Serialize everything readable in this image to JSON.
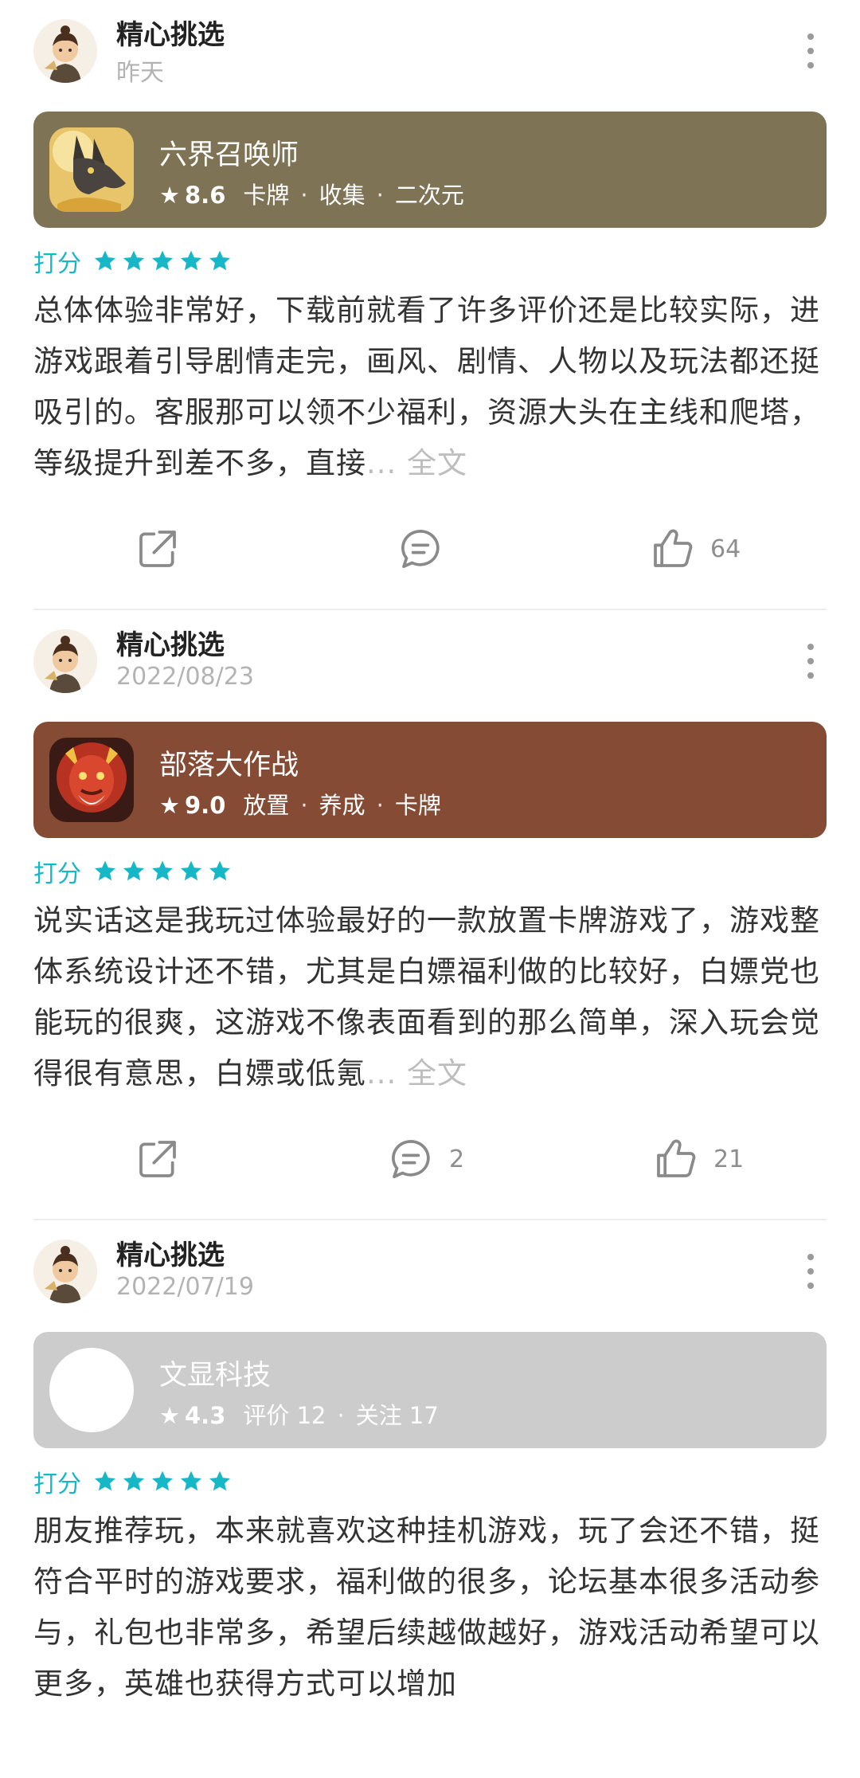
{
  "posts": [
    {
      "author": "精心挑选",
      "date": "昨天",
      "game": {
        "name": "六界召唤师",
        "score": "8.6",
        "tags": [
          "卡牌",
          "收集",
          "二次元"
        ],
        "bg_color": "#7f7355",
        "icon": "anubis-dog-icon"
      },
      "rating_label": "打分",
      "stars": 5,
      "content": "总体体验非常好，下载前就看了许多评价还是比较实际，进游戏跟着引导剧情走完，画风、剧情、人物以及玩法都还挺吸引的。客服那可以领不少福利，资源大头在主线和爬塔，等级提升到差不多，直接",
      "more_text": "... 全文",
      "share_count": "",
      "comment_count": "",
      "like_count": "64"
    },
    {
      "author": "精心挑选",
      "date": "2022/08/23",
      "game": {
        "name": "部落大作战",
        "score": "9.0",
        "tags": [
          "放置",
          "养成",
          "卡牌"
        ],
        "bg_color": "#864b34",
        "icon": "warrior-face-icon"
      },
      "rating_label": "打分",
      "stars": 5,
      "content": "说实话这是我玩过体验最好的一款放置卡牌游戏了，游戏整体系统设计还不错，尤其是白嫖福利做的比较好，白嫖党也能玩的很爽，这游戏不像表面看到的那么简单，深入玩会觉得很有意思，白嫖或低氪",
      "more_text": "... 全文",
      "share_count": "",
      "comment_count": "2",
      "like_count": "21"
    },
    {
      "author": "精心挑选",
      "date": "2022/07/19",
      "game": {
        "name": "文显科技",
        "score": "4.3",
        "tags": [
          "评价 12",
          "关注 17"
        ],
        "bg_color": "#cccccc",
        "icon": "blank-circle-icon"
      },
      "rating_label": "打分",
      "stars": 5,
      "content": "朋友推荐玩，本来就喜欢这种挂机游戏，玩了会还不错，挺符合平时的游戏要求，福利做的很多，论坛基本很多活动参与，礼包也非常多，希望后续越做越好，游戏活动希望可以更多，英雄也获得方式可以增加",
      "more_text": "",
      "share_count": "",
      "comment_count": "",
      "like_count": ""
    }
  ],
  "colors": {
    "accent": "#16b8c8",
    "muted": "#b3b3b3"
  }
}
